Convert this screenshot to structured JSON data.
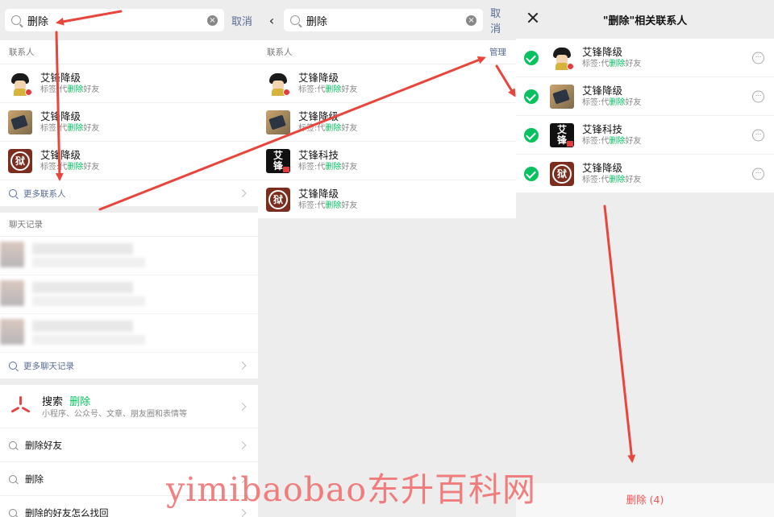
{
  "panel1": {
    "search_query": "删除",
    "cancel": "取消",
    "contacts_label": "联系人",
    "contacts": [
      {
        "name": "艾锋降级",
        "tag_prefix": "标签:代",
        "tag_highlight": "删除",
        "tag_suffix": "好友",
        "avatar": "cartoon-avatar"
      },
      {
        "name": "艾锋降级",
        "tag_prefix": "标签:代",
        "tag_highlight": "删除",
        "tag_suffix": "好友",
        "avatar": "device-photo-avatar"
      },
      {
        "name": "艾锋降级",
        "tag_prefix": "标签:代",
        "tag_highlight": "删除",
        "tag_suffix": "好友",
        "avatar": "seal-avatar"
      }
    ],
    "more_contacts": "更多联系人",
    "chat_label": "聊天记录",
    "more_chats": "更多聊天记录",
    "websearch": {
      "title": "搜索",
      "keyword": "删除",
      "sub": "小程序、公众号、文章、朋友圈和表情等"
    },
    "suggestions": [
      "删除好友",
      "删除",
      "删除的好友怎么找回"
    ]
  },
  "panel2": {
    "search_query": "删除",
    "cancel": "取消",
    "contacts_label": "联系人",
    "manage": "管理",
    "contacts": [
      {
        "name": "艾锋降级",
        "tag_prefix": "标签:代",
        "tag_highlight": "删除",
        "tag_suffix": "好友",
        "avatar": "cartoon-avatar"
      },
      {
        "name": "艾锋降级",
        "tag_prefix": "标签:代",
        "tag_highlight": "删除",
        "tag_suffix": "好友",
        "avatar": "device-photo-avatar"
      },
      {
        "name": "艾锋科技",
        "tag_prefix": "标签:代",
        "tag_highlight": "删除",
        "tag_suffix": "好友",
        "avatar": "text-logo-avatar"
      },
      {
        "name": "艾锋降级",
        "tag_prefix": "标签:代",
        "tag_highlight": "删除",
        "tag_suffix": "好友",
        "avatar": "seal-avatar"
      }
    ]
  },
  "panel3": {
    "title": "\"删除\"相关联系人",
    "contacts": [
      {
        "name": "艾锋降级",
        "tag_prefix": "标签:代",
        "tag_highlight": "删除",
        "tag_suffix": "好友",
        "avatar": "cartoon-avatar"
      },
      {
        "name": "艾锋降级",
        "tag_prefix": "标签:代",
        "tag_highlight": "删除",
        "tag_suffix": "好友",
        "avatar": "device-photo-avatar"
      },
      {
        "name": "艾锋科技",
        "tag_prefix": "标签:代",
        "tag_highlight": "删除",
        "tag_suffix": "好友",
        "avatar": "text-logo-avatar"
      },
      {
        "name": "艾锋降级",
        "tag_prefix": "标签:代",
        "tag_highlight": "删除",
        "tag_suffix": "好友",
        "avatar": "seal-avatar"
      }
    ],
    "delete_button": "删除 (4)"
  },
  "avatar_glyphs": {
    "seal": "狱",
    "logo_line1": "艾",
    "logo_line2": "锋"
  },
  "watermark": "yimibaobao东升百科网",
  "colors": {
    "accent_link": "#576b95",
    "highlight_green": "#07c160",
    "danger_red": "#fa5151",
    "arrow_red": "#e8453c"
  }
}
